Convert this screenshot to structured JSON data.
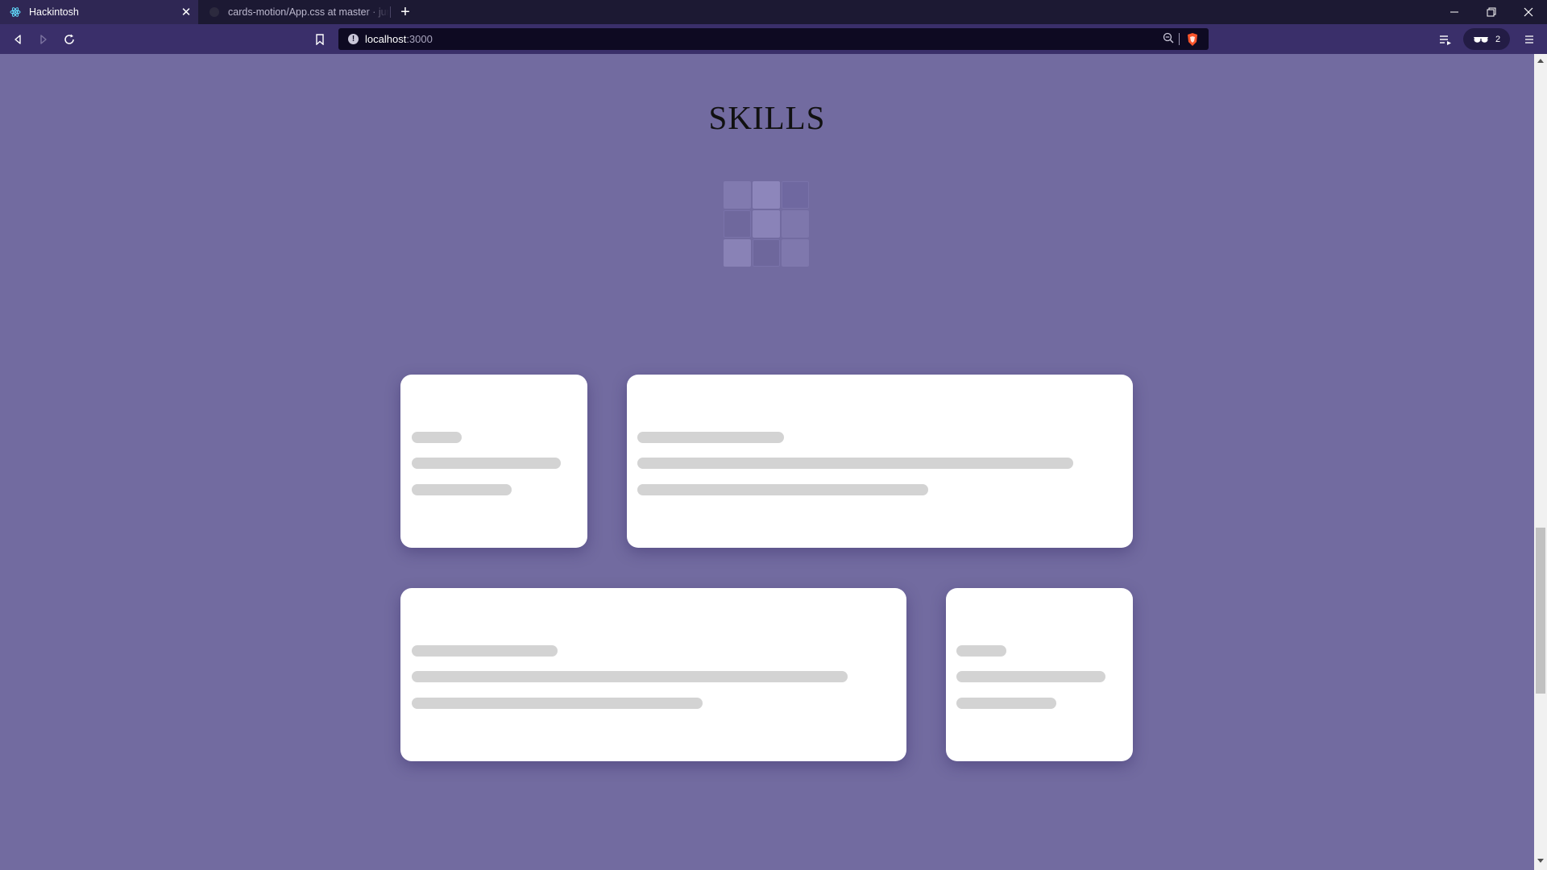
{
  "browser": {
    "tabs": [
      {
        "title": "Hackintosh",
        "active": true
      },
      {
        "title": "cards-motion/App.css at master · junior",
        "active": false
      }
    ],
    "url": {
      "host": "localhost",
      "port": ":3000"
    },
    "shields_count": "2"
  },
  "page": {
    "heading": "SKILLS"
  },
  "colors": {
    "page_background": "#726ba0",
    "tabstrip": "#1c1933",
    "toolbar": "#3a2f6a",
    "card": "#ffffff",
    "skeleton": "#d3d3d3",
    "brave_orange": "#fb542b"
  },
  "icons": {
    "back": "back-icon",
    "forward": "forward-icon",
    "reload": "reload-icon",
    "bookmark": "bookmark-icon",
    "site_info": "info-icon",
    "zoom": "zoom-out-icon",
    "shields": "brave-shields-icon",
    "playlist": "playlist-icon",
    "extension": "sunglasses-icon",
    "menu": "hamburger-menu-icon"
  }
}
